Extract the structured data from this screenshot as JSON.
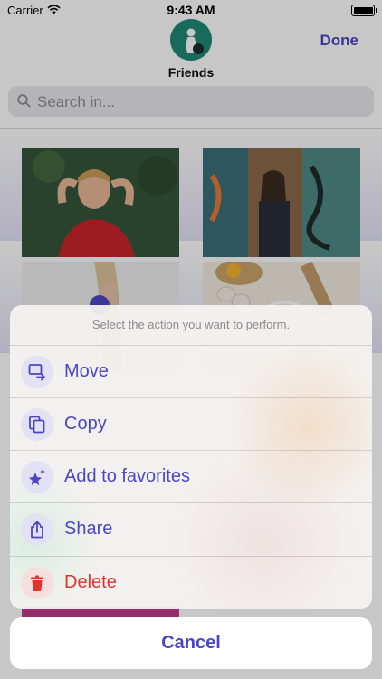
{
  "status_bar": {
    "carrier": "Carrier",
    "time": "9:43 AM"
  },
  "header": {
    "title": "Friends",
    "done_label": "Done"
  },
  "search": {
    "placeholder": "Search in..."
  },
  "action_sheet": {
    "message": "Select the action you want to perform.",
    "items": [
      {
        "label": "Move",
        "icon": "move-icon"
      },
      {
        "label": "Copy",
        "icon": "copy-icon"
      },
      {
        "label": "Add to favorites",
        "icon": "star-sparkle-icon"
      },
      {
        "label": "Share",
        "icon": "share-icon"
      },
      {
        "label": "Delete",
        "icon": "trash-icon"
      }
    ],
    "cancel_label": "Cancel"
  },
  "colors": {
    "accent": "#4c46c2",
    "destructive": "#e0342b",
    "avatar_bg": "#1f8a76"
  }
}
